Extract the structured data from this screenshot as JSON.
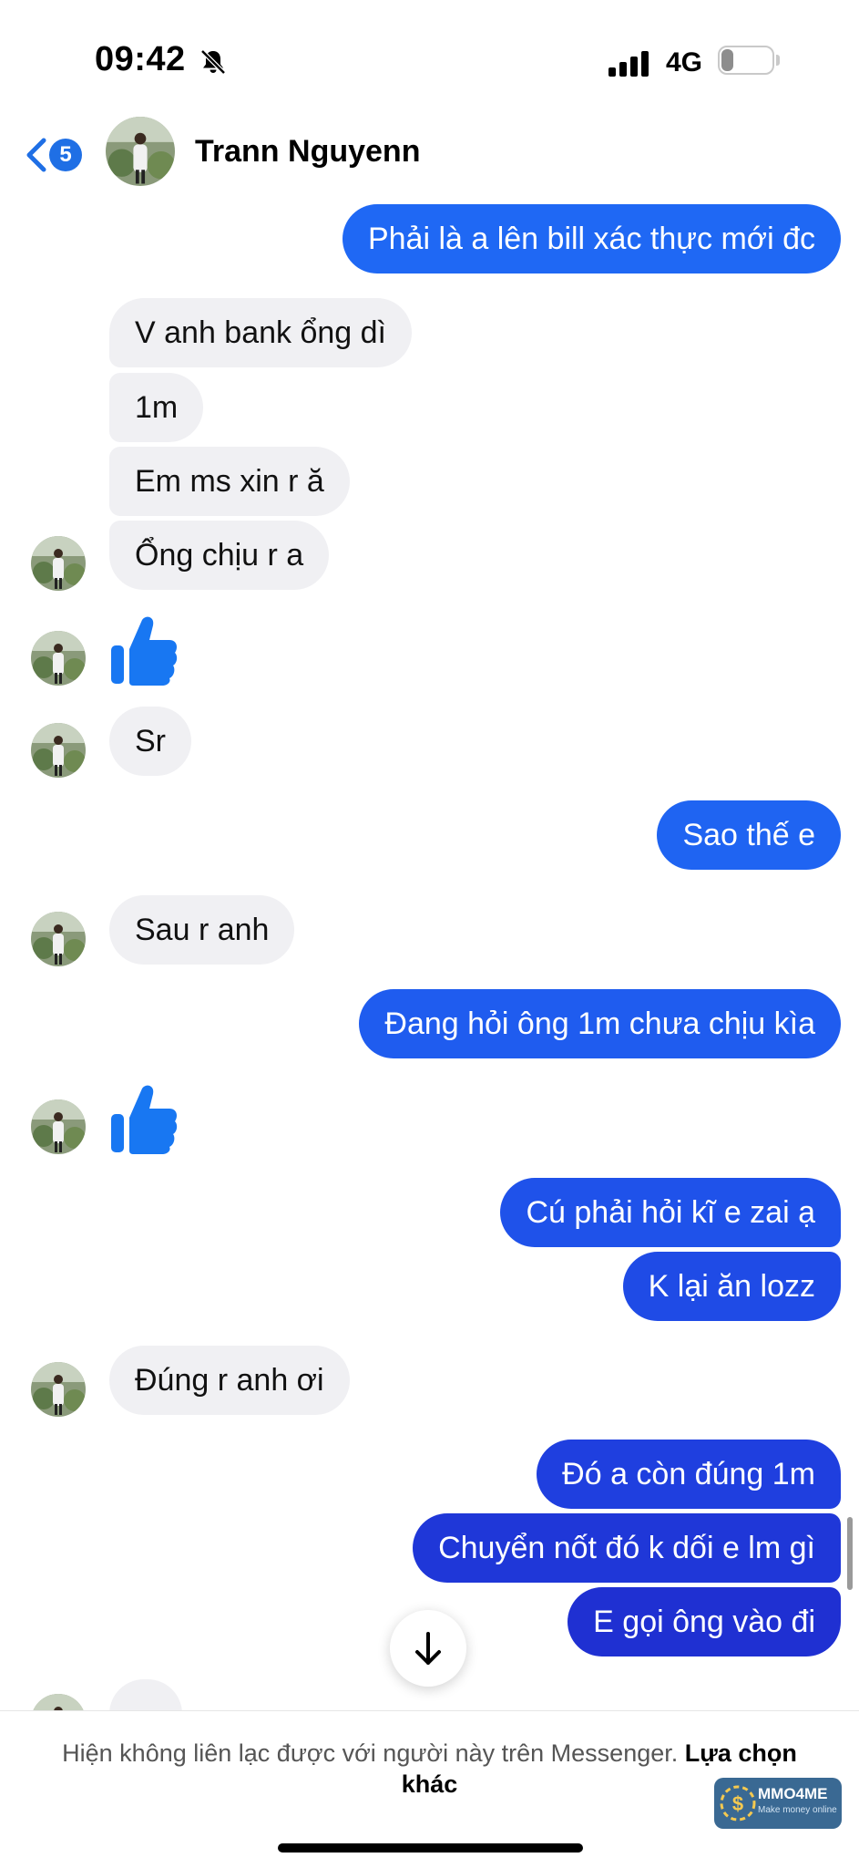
{
  "status_bar": {
    "time": "09:42",
    "network": "4G",
    "battery": "23",
    "battery_level": 0.23,
    "icons": [
      "bell-slash-icon",
      "signal-icon"
    ]
  },
  "header": {
    "back_badge": "5",
    "contact_name": "Trann Nguyenn",
    "icons": [
      "chevron-left-icon"
    ]
  },
  "messages": [
    {
      "side": "sent",
      "text": "Phải là a lên bill xác thực mới đc"
    },
    {
      "side": "received",
      "text": "V anh bank ổng dì"
    },
    {
      "side": "received",
      "text": "1m"
    },
    {
      "side": "received",
      "text": "Em ms xin r ă"
    },
    {
      "side": "received",
      "text": "Ổng chịu r a"
    },
    {
      "side": "received",
      "type": "like",
      "icon": "thumbs-up-icon"
    },
    {
      "side": "received",
      "text": "Sr"
    },
    {
      "side": "sent",
      "text": "Sao thế e"
    },
    {
      "side": "received",
      "text": "Sau r anh"
    },
    {
      "side": "sent",
      "text": "Đang hỏi ông 1m chưa chịu kìa"
    },
    {
      "side": "received",
      "type": "like",
      "icon": "thumbs-up-icon"
    },
    {
      "side": "sent",
      "text": "Cú phải hỏi kĩ e zai ạ"
    },
    {
      "side": "sent",
      "text": "K lại ăn lozz"
    },
    {
      "side": "received",
      "text": "Đúng r anh ơi"
    },
    {
      "side": "sent",
      "text": "Đó a còn đúng 1m"
    },
    {
      "side": "sent",
      "text": "Chuyển nốt đó k dối e lm gì"
    },
    {
      "side": "sent",
      "text": "E gọi ông vào đi"
    }
  ],
  "scroll_down": {
    "icon": "arrow-down-icon"
  },
  "footer": {
    "notice": "Hiện không liên lạc được với người này trên Messenger.",
    "link": "Lựa chọn khác"
  },
  "watermark": {
    "title": "MMO4ME",
    "subtitle": "Make money online"
  },
  "colors": {
    "received_bubble": "#f0f0f3",
    "sent_bubble_top": "#1f66f5",
    "sent_bubble_bottom": "#1f2fd0",
    "like": "#1877f2"
  }
}
